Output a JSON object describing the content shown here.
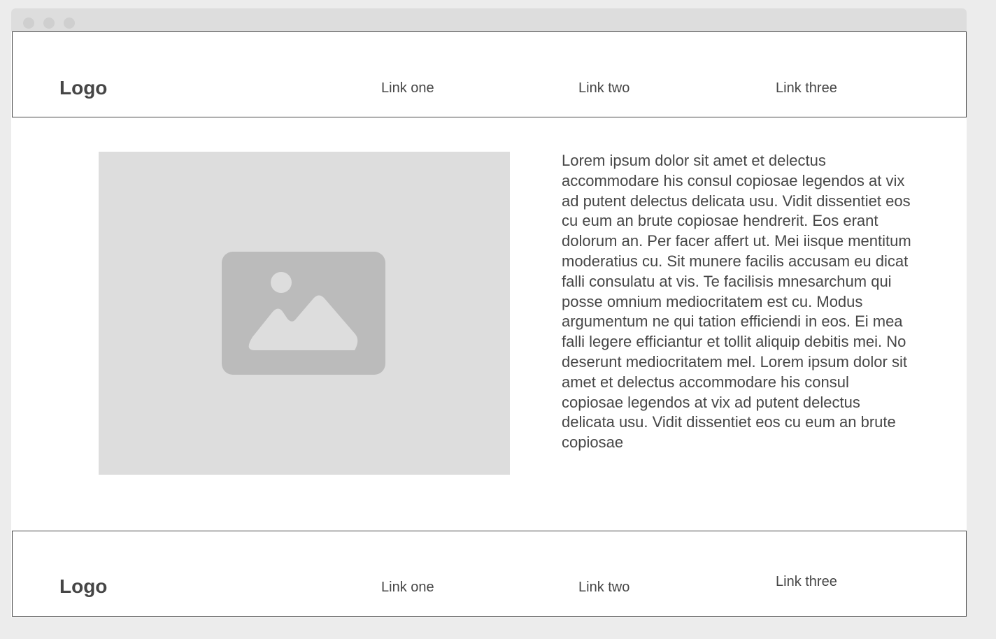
{
  "header": {
    "logo": "Logo",
    "links": [
      "Link one",
      "Link two",
      "Link three"
    ]
  },
  "main": {
    "image_icon": "image-placeholder-icon",
    "text": "Lorem ipsum dolor sit amet et delectus accommodare his consul copiosae legendos at vix ad putent delectus delicata usu. Vidit dissentiet eos cu eum an brute copiosae hendrerit. Eos erant dolorum an. Per facer affert ut. Mei iisque mentitum moderatius cu. Sit munere facilis accusam eu dicat falli consulatu at vis. Te facilisis mnesarchum qui posse omnium mediocritatem est cu. Modus argumentum ne qui tation efficiendi in eos. Ei mea falli legere efficiantur et tollit aliquip debitis mei. No deserunt mediocritatem mel. Lorem ipsum dolor sit amet et delectus accommodare his consul copiosae legendos at vix ad putent delectus delicata usu. Vidit dissentiet eos cu eum an brute copiosae"
  },
  "footer": {
    "logo": "Logo",
    "links": [
      "Link one",
      "Link two",
      "Link three"
    ]
  },
  "colors": {
    "background": "#ececec",
    "window": "#ffffff",
    "titlebar": "#dddddd",
    "placeholder": "#dddddd",
    "icon": "#bbbbbb",
    "text": "#464646"
  }
}
